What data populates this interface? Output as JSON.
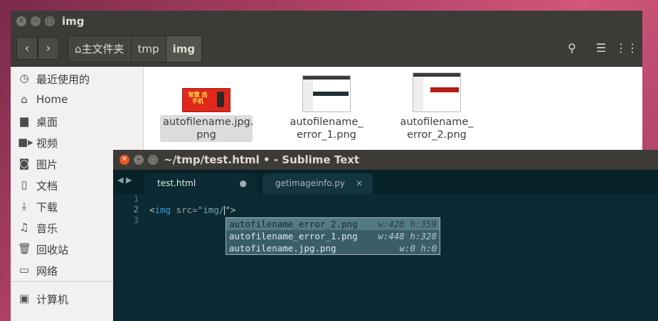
{
  "file_manager": {
    "window_title": "img",
    "breadcrumbs": [
      "主文件夹",
      "tmp",
      "img"
    ],
    "sidebar": [
      {
        "icon": "clock-icon",
        "label": "最近使用的"
      },
      {
        "icon": "home-icon",
        "label": "Home"
      },
      {
        "icon": "desktop-folder-icon",
        "label": "桌面"
      },
      {
        "icon": "video-icon",
        "label": "视频"
      },
      {
        "icon": "camera-icon",
        "label": "图片"
      },
      {
        "icon": "document-icon",
        "label": "文档"
      },
      {
        "icon": "download-icon",
        "label": "下载"
      },
      {
        "icon": "music-icon",
        "label": "音乐"
      },
      {
        "icon": "trash-icon",
        "label": "回收站"
      },
      {
        "icon": "network-icon",
        "label": "网络"
      },
      {
        "icon": "computer-icon",
        "label": "计算机"
      }
    ],
    "files": [
      {
        "name_line1": "autofilename.jpg.",
        "name_line2": "png",
        "selected": true,
        "thumb_text": "智慧 选手机"
      },
      {
        "name_line1": "autofilename_",
        "name_line2": "error_1.png",
        "selected": false
      },
      {
        "name_line1": "autofilename_",
        "name_line2": "error_2.png",
        "selected": false
      }
    ]
  },
  "sublime": {
    "window_title": "~/tmp/test.html • - Sublime Text",
    "tabs": [
      {
        "label": "test.html",
        "marker": "●"
      },
      {
        "label": "getimageinfo.py",
        "marker": "×"
      }
    ],
    "line_numbers": [
      "1",
      "2",
      "3"
    ],
    "code_line2": {
      "tag_open": "<",
      "tag": "img",
      "attr": " src=",
      "str": "\"img/",
      "after": "\">"
    },
    "autocomplete": [
      {
        "name": "autofilename_error_2.png",
        "hint": "w:428 h:359"
      },
      {
        "name": "autofilename_error_1.png",
        "hint": "w:448 h:328"
      },
      {
        "name": "autofilename.jpg.png",
        "hint": "w:0 h:0"
      }
    ]
  }
}
